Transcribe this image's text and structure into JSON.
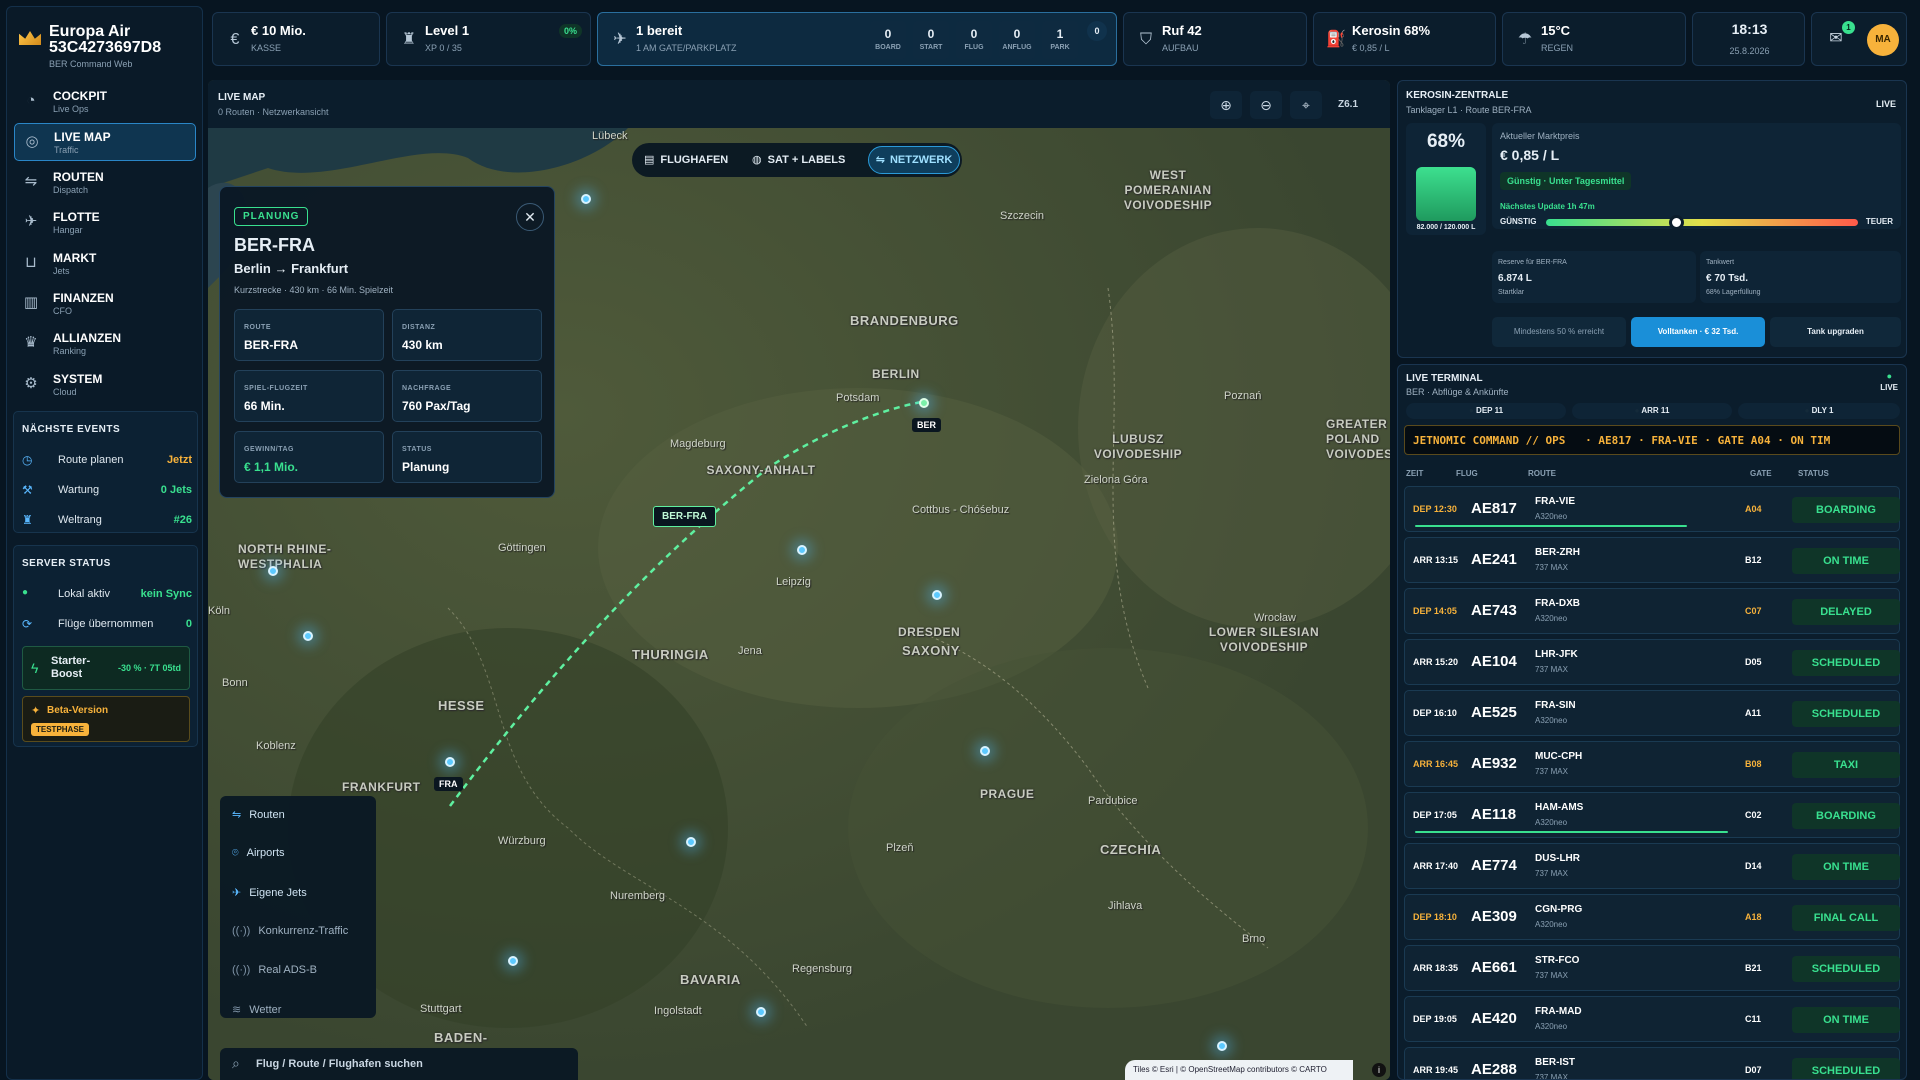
{
  "sidebar": {
    "brand_line1": "Europa Air",
    "brand_line2": "53C4273697D8",
    "brand_sub": "BER Command Web",
    "nav": [
      {
        "label": "COCKPIT",
        "sub": "Live Ops"
      },
      {
        "label": "LIVE MAP",
        "sub": "Traffic"
      },
      {
        "label": "ROUTEN",
        "sub": "Dispatch"
      },
      {
        "label": "FLOTTE",
        "sub": "Hangar"
      },
      {
        "label": "MARKT",
        "sub": "Jets"
      },
      {
        "label": "FINANZEN",
        "sub": "CFO"
      },
      {
        "label": "ALLIANZEN",
        "sub": "Ranking"
      },
      {
        "label": "SYSTEM",
        "sub": "Cloud"
      }
    ],
    "events_title": "NÄCHSTE EVENTS",
    "events": [
      {
        "label": "Route planen",
        "value": "Jetzt"
      },
      {
        "label": "Wartung",
        "value": "0 Jets"
      },
      {
        "label": "Weltrang",
        "value": "#26"
      }
    ],
    "server_title": "SERVER STATUS",
    "server": [
      {
        "label": "Lokal aktiv",
        "value": "kein Sync"
      },
      {
        "label": "Flüge übernommen",
        "value": "0"
      }
    ],
    "boost_label": "Starter-Boost",
    "boost_value": "-30 % · 7T 05td",
    "beta_label": "Beta-Version",
    "beta_badge": "TESTPHASE"
  },
  "top": {
    "cash_value": "€ 10 Mio.",
    "cash_label": "KASSE",
    "level_value": "Level 1",
    "level_label": "XP 0 / 35",
    "level_pct": "0%",
    "ready_value": "1 bereit",
    "ready_label": "1 AM GATE/PARKPLATZ",
    "counters": [
      {
        "n": "0",
        "l": "BOARD"
      },
      {
        "n": "0",
        "l": "START"
      },
      {
        "n": "0",
        "l": "FLUG"
      },
      {
        "n": "0",
        "l": "ANFLUG"
      },
      {
        "n": "1",
        "l": "PARK"
      }
    ],
    "counter_extra": "0",
    "ruf_value": "Ruf 42",
    "ruf_label": "AUFBAU",
    "kero_value": "Kerosin 68%",
    "kero_label": "€ 0,85 / L",
    "weather_value": "15°C",
    "weather_label": "REGEN",
    "time": "18:13",
    "date": "25.8.2026",
    "mail_count": "1",
    "avatar": "MA"
  },
  "map": {
    "title": "LIVE MAP",
    "subtitle": "0 Routen · Netzwerkansicht",
    "zoom": "Z6.1",
    "toggles": [
      "FLUGHAFEN",
      "SAT + LABELS",
      "NETZWERK"
    ],
    "regions": [
      "WEST POMERANIAN VOIVODESHIP",
      "BRANDENBURG",
      "BERLIN",
      "SAXONY-ANHALT",
      "LUBUSZ VOIVODESHIP",
      "GREATER POLAND VOIVODESHIP",
      "NORTH RHINE-WESTPHALIA",
      "THURINGIA",
      "DRESDEN",
      "SAXONY",
      "LOWER SILESIAN VOIVODESHIP",
      "HESSE",
      "FRANKFURT",
      "PRAGUE",
      "CZECHIA",
      "BAVARIA",
      "BADEN-"
    ],
    "cities": [
      "Lübeck",
      "Szczecin",
      "Potsdam",
      "Magdeburg",
      "Poznań",
      "Zielona Góra",
      "Göttingen",
      "Leipzig",
      "Cottbus - Chóśebuz",
      "Wrocław",
      "Bonn",
      "Jena",
      "Koblenz",
      "Würzburg",
      "Pardubice",
      "Plzeň",
      "Nuremberg",
      "Jihlava",
      "Regensburg",
      "Brno",
      "Ingolstadt",
      "Stuttgart",
      "Köln"
    ],
    "tags": {
      "ber": "BER",
      "fra": "FRA",
      "route": "BER-FRA"
    },
    "layers": [
      "Routen",
      "Airports",
      "Eigene Jets",
      "Konkurrenz-Traffic",
      "Real ADS-B",
      "Wetter"
    ],
    "search_placeholder": "Flug / Route / Flughafen suchen",
    "attribution": "Tiles © Esri | © OpenStreetMap contributors © CARTO"
  },
  "card": {
    "badge": "PLANUNG",
    "route": "BER-FRA",
    "cities": "Berlin → Frankfurt",
    "desc": "Kurzstrecke · 430 km · 66 Min. Spielzeit",
    "cells": [
      {
        "label": "ROUTE",
        "value": "BER-FRA"
      },
      {
        "label": "DISTANZ",
        "value": "430 km"
      },
      {
        "label": "SPIEL-FLUGZEIT",
        "value": "66 Min."
      },
      {
        "label": "NACHFRAGE",
        "value": "760 Pax/Tag"
      },
      {
        "label": "GEWINN/TAG",
        "value": "€ 1,1 Mio."
      },
      {
        "label": "STATUS",
        "value": "Planung"
      }
    ]
  },
  "kero": {
    "title": "KEROSIN-ZENTRALE",
    "subtitle": "Tanklager L1 · Route BER-FRA",
    "live": "LIVE",
    "pct": "68%",
    "fill_fraction": 0.68,
    "capacity": "82.000 / 120.000 L",
    "price_label": "Aktueller Marktpreis",
    "price": "€ 0,85 / L",
    "price_badge": "Günstig · Unter Tagesmittel",
    "update": "Nächstes Update 1h 47m",
    "scale_low": "GÜNSTIG",
    "scale_high": "TEUER",
    "scale_position": 0.42,
    "reserve_label": "Reserve für BER-FRA",
    "reserve_value": "6.874 L",
    "reserve_sub": "Startklar",
    "tank_label": "Tankwert",
    "tank_value": "€ 70 Tsd.",
    "tank_sub": "68% Lagerfüllung",
    "btn_min": "Mindestens 50 % erreicht",
    "btn_full": "Volltanken · € 32 Tsd.",
    "btn_up": "Tank upgraden"
  },
  "terminal": {
    "title": "LIVE TERMINAL",
    "subtitle": "BER · Abflüge & Ankünfte",
    "live": "LIVE",
    "tabs": [
      "DEP 11",
      "ARR 11",
      "DLY 1"
    ],
    "ticker": "JETNOMIC COMMAND // OPS   · AE817 · FRA-VIE · GATE A04 · ON TIM",
    "headers": [
      "ZEIT",
      "FLUG",
      "ROUTE",
      "GATE",
      "STATUS"
    ],
    "colors": {
      "dep": "#f7b23b",
      "arr": "#ffffff",
      "green": "#39e08f"
    },
    "flights": [
      {
        "time": "DEP 12:30",
        "flight": "AE817",
        "route": "FRA-VIE",
        "ac": "A320neo",
        "gate": "A04",
        "status": "BOARDING",
        "dep": true,
        "progress": 0.8
      },
      {
        "time": "ARR 13:15",
        "flight": "AE241",
        "route": "BER-ZRH",
        "ac": "737 MAX",
        "gate": "B12",
        "status": "ON TIME",
        "dep": false
      },
      {
        "time": "DEP 14:05",
        "flight": "AE743",
        "route": "FRA-DXB",
        "ac": "A320neo",
        "gate": "C07",
        "status": "DELAYED",
        "dep": true
      },
      {
        "time": "ARR 15:20",
        "flight": "AE104",
        "route": "LHR-JFK",
        "ac": "737 MAX",
        "gate": "D05",
        "status": "SCHEDULED",
        "dep": false
      },
      {
        "time": "DEP 16:10",
        "flight": "AE525",
        "route": "FRA-SIN",
        "ac": "A320neo",
        "gate": "A11",
        "status": "SCHEDULED",
        "dep": false
      },
      {
        "time": "ARR 16:45",
        "flight": "AE932",
        "route": "MUC-CPH",
        "ac": "737 MAX",
        "gate": "B08",
        "status": "TAXI",
        "dep": true
      },
      {
        "time": "DEP 17:05",
        "flight": "AE118",
        "route": "HAM-AMS",
        "ac": "A320neo",
        "gate": "C02",
        "status": "BOARDING",
        "dep": false,
        "progress": 0.92
      },
      {
        "time": "ARR 17:40",
        "flight": "AE774",
        "route": "DUS-LHR",
        "ac": "737 MAX",
        "gate": "D14",
        "status": "ON TIME",
        "dep": false
      },
      {
        "time": "DEP 18:10",
        "flight": "AE309",
        "route": "CGN-PRG",
        "ac": "A320neo",
        "gate": "A18",
        "status": "FINAL CALL",
        "dep": true
      },
      {
        "time": "ARR 18:35",
        "flight": "AE661",
        "route": "STR-FCO",
        "ac": "737 MAX",
        "gate": "B21",
        "status": "SCHEDULED",
        "dep": false
      },
      {
        "time": "DEP 19:05",
        "flight": "AE420",
        "route": "FRA-MAD",
        "ac": "A320neo",
        "gate": "C11",
        "status": "ON TIME",
        "dep": false
      },
      {
        "time": "ARR 19:45",
        "flight": "AE288",
        "route": "BER-IST",
        "ac": "737 MAX",
        "gate": "D07",
        "status": "SCHEDULED",
        "dep": false
      }
    ]
  }
}
